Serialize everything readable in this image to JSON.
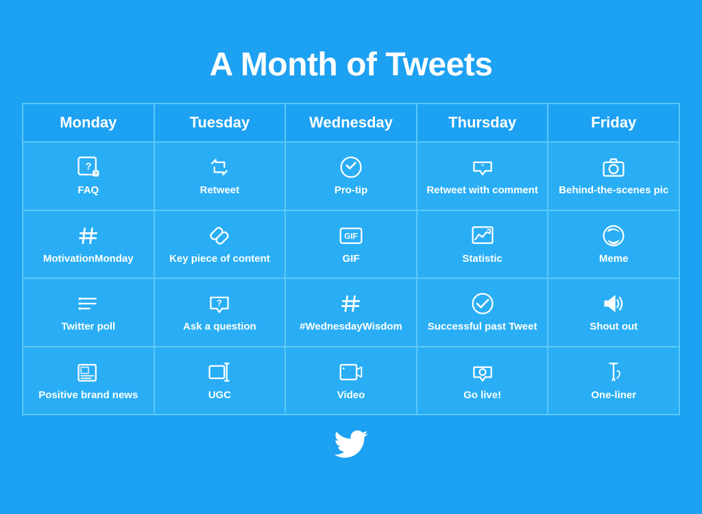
{
  "title": "A Month of Tweets",
  "headers": [
    "Monday",
    "Tuesday",
    "Wednesday",
    "Thursday",
    "Friday"
  ],
  "rows": [
    [
      {
        "label": "FAQ",
        "icon": "faq"
      },
      {
        "label": "Retweet",
        "icon": "retweet"
      },
      {
        "label": "Pro-tip",
        "icon": "protip"
      },
      {
        "label": "Retweet with comment",
        "icon": "retweet-comment"
      },
      {
        "label": "Behind-the-scenes pic",
        "icon": "camera"
      }
    ],
    [
      {
        "label": "MotivationMonday",
        "icon": "hashtag"
      },
      {
        "label": "Key piece of content",
        "icon": "link"
      },
      {
        "label": "GIF",
        "icon": "gif"
      },
      {
        "label": "Statistic",
        "icon": "statistic"
      },
      {
        "label": "Meme",
        "icon": "meme"
      }
    ],
    [
      {
        "label": "Twitter poll",
        "icon": "poll"
      },
      {
        "label": "Ask a question",
        "icon": "question"
      },
      {
        "label": "#WednesdayWisdom",
        "icon": "hashtag"
      },
      {
        "label": "Successful past Tweet",
        "icon": "success"
      },
      {
        "label": "Shout out",
        "icon": "megaphone"
      }
    ],
    [
      {
        "label": "Positive brand news",
        "icon": "newspaper"
      },
      {
        "label": "UGC",
        "icon": "ugc"
      },
      {
        "label": "Video",
        "icon": "video"
      },
      {
        "label": "Go live!",
        "icon": "camera-video"
      },
      {
        "label": "One-liner",
        "icon": "oneliner"
      }
    ]
  ]
}
